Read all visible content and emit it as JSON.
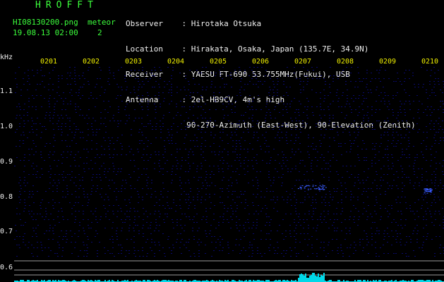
{
  "header": {
    "logo": "HROFFT",
    "filename": "HI08130200.png",
    "meteor_label": "meteor",
    "datetime": "19.08.13 02:00",
    "meteor_count": "2",
    "observer_key": "Observer",
    "observer_val": "Hirotaka Otsuka",
    "location_key": "Location",
    "location_val": "Hirakata, Osaka, Japan (135.7E, 34.9N)",
    "receiver_key": "Receiver",
    "receiver_val": "YAESU FT-690 53.755MHz(Fukui), USB",
    "antenna_key": "Antenna",
    "antenna_val": "2el-HB9CV, 4m's high",
    "antenna_val2": "90-270-Azimuth (East-West), 90-Elevation (Zenith)"
  },
  "chart_data": {
    "type": "heatmap",
    "ylabel": "kHz",
    "x_ticks": [
      "0201",
      "0202",
      "0203",
      "0204",
      "0205",
      "0206",
      "0207",
      "0208",
      "0209",
      "0210"
    ],
    "y_ticks": [
      "1.1",
      "1.0",
      "0.9",
      "0.8",
      "0.7",
      "0.6"
    ],
    "ylim": [
      0.57,
      1.2
    ],
    "colors": {
      "background": "#000000",
      "noise": "#0a0a6e",
      "echo": "#3a5cff",
      "baseline": "#00d8e8"
    },
    "meteor_echoes": [
      {
        "time": "0207",
        "freq_khz": 0.83,
        "duration_min": 0.7
      },
      {
        "time": "0210",
        "freq_khz": 0.82,
        "duration_min": 0.2
      }
    ]
  }
}
